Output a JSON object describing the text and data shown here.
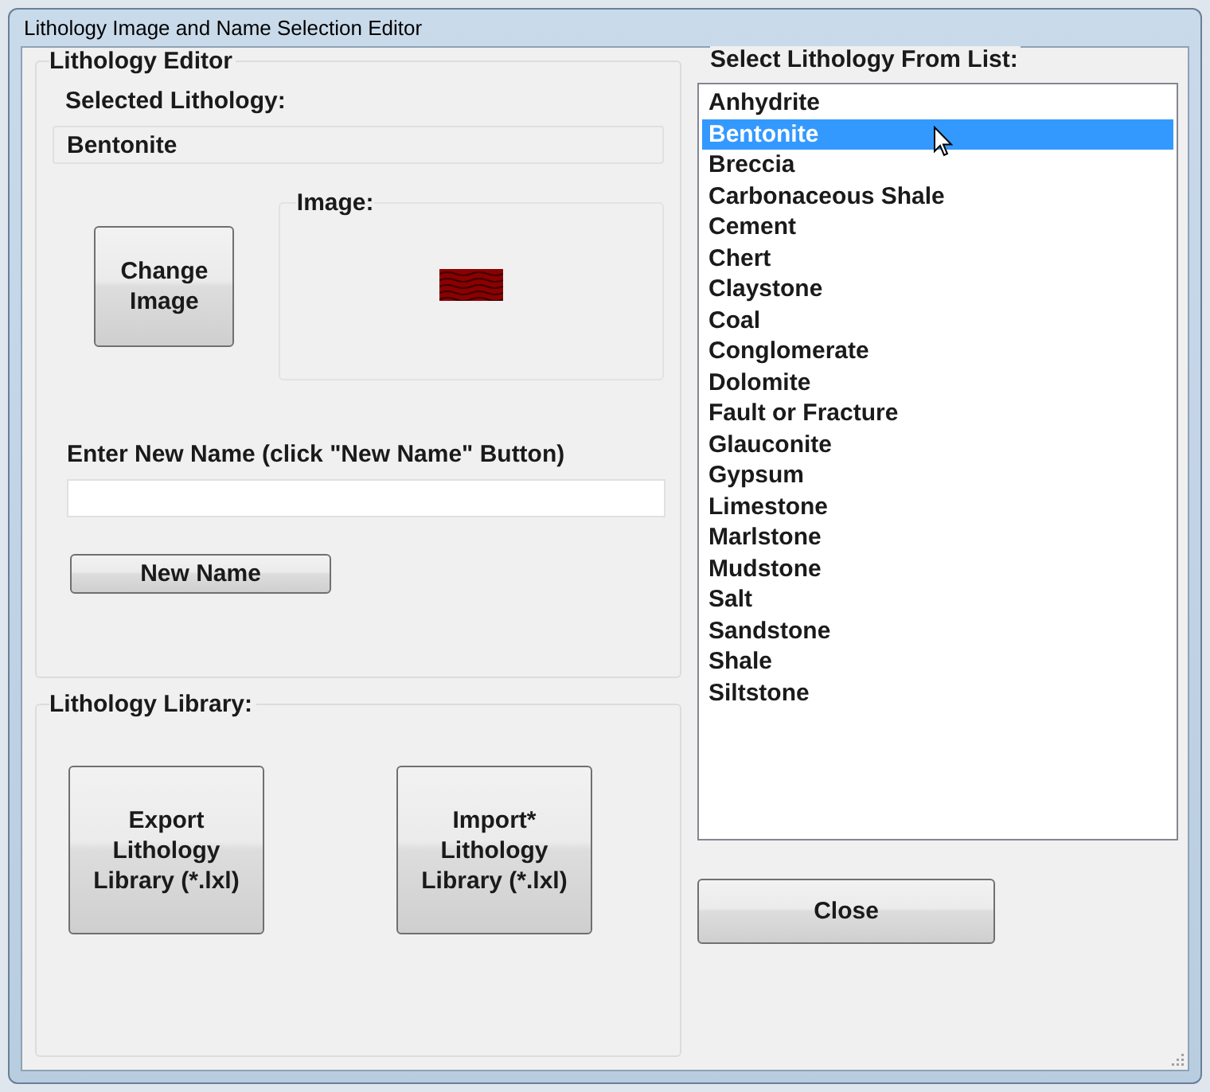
{
  "window": {
    "title": "Lithology Image and Name Selection Editor"
  },
  "editor": {
    "title": "Lithology Editor",
    "selected_label": "Selected Lithology:",
    "selected_value": "Bentonite",
    "image_label": "Image:",
    "change_image_button": "Change Image",
    "name_label": "Enter New Name (click \"New Name\" Button)",
    "new_name_button": "New Name"
  },
  "library": {
    "title": "Lithology Library:",
    "buttons": [
      "Export Lithology Library (*.lxl)",
      "Import* Lithology Library (*.lxl)"
    ]
  },
  "list": {
    "title": "Select Lithology From List:",
    "items": [
      {
        "label": "Anhydrite",
        "selected": false
      },
      {
        "label": "Bentonite",
        "selected": true
      },
      {
        "label": "Breccia",
        "selected": false
      },
      {
        "label": "Carbonaceous Shale",
        "selected": false
      },
      {
        "label": "Cement",
        "selected": false
      },
      {
        "label": "Chert",
        "selected": false
      },
      {
        "label": "Claystone",
        "selected": false
      },
      {
        "label": "Coal",
        "selected": false
      },
      {
        "label": "Conglomerate",
        "selected": false
      },
      {
        "label": "Dolomite",
        "selected": false
      },
      {
        "label": "Fault or Fracture",
        "selected": false
      },
      {
        "label": "Glauconite",
        "selected": false
      },
      {
        "label": "Gypsum",
        "selected": false
      },
      {
        "label": "Limestone",
        "selected": false
      },
      {
        "label": "Marlstone",
        "selected": false
      },
      {
        "label": "Mudstone",
        "selected": false
      },
      {
        "label": "Salt",
        "selected": false
      },
      {
        "label": "Sandstone",
        "selected": false
      },
      {
        "label": "Shale",
        "selected": false
      },
      {
        "label": "Siltstone",
        "selected": false
      }
    ]
  },
  "close_button": "Close"
}
